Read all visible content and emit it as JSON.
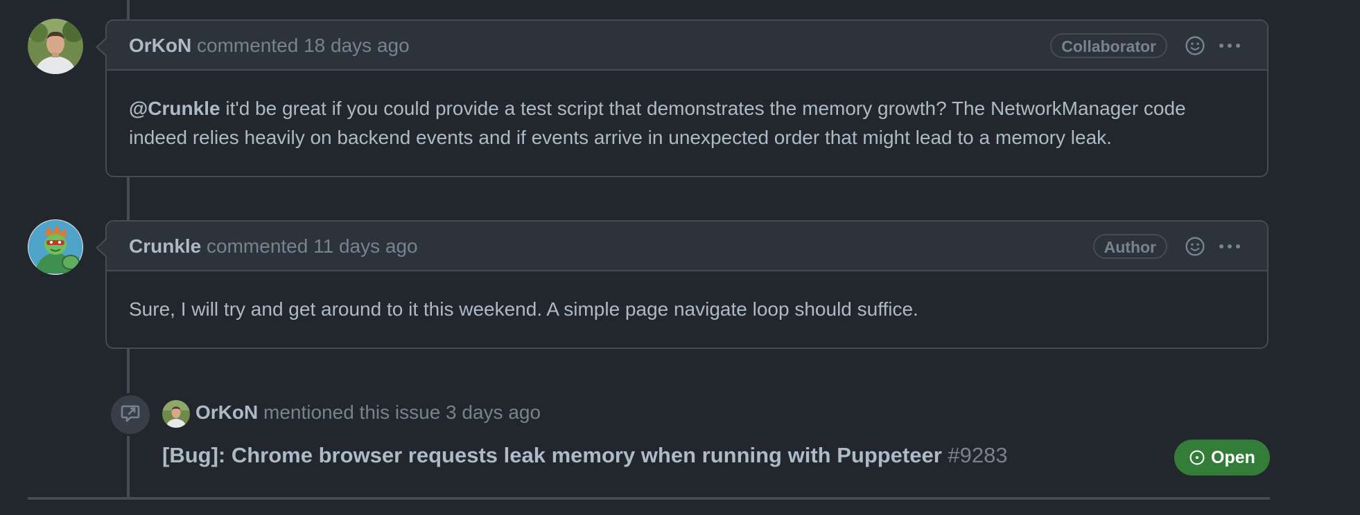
{
  "comments": [
    {
      "author": "OrKoN",
      "action": " commented ",
      "time": "18 days ago",
      "role": "Collaborator",
      "avatar_icon": "avatar-photo-man",
      "body_mention": "@Crunkle",
      "body_text": " it'd be great if you could provide a test script that demonstrates the memory growth? The NetworkManager code indeed relies heavily on backend events and if events arrive in unexpected order that might lead to a memory leak."
    },
    {
      "author": "Crunkle",
      "action": " commented ",
      "time": "11 days ago",
      "role": "Author",
      "avatar_icon": "avatar-cartoon-turtle",
      "body_text": "Sure, I will try and get around to it this weekend. A simple page navigate loop should suffice."
    }
  ],
  "event": {
    "icon": "cross-reference-icon",
    "actor": "OrKoN",
    "action": " mentioned this issue ",
    "time": "3 days ago",
    "issue_title": "[Bug]: Chrome browser requests leak memory when running with Puppeteer",
    "issue_number": "#9283",
    "state": "Open",
    "state_color": "#347d39"
  },
  "icons": {
    "reaction": "smiley-icon",
    "menu": "kebab-icon",
    "state": "issue-opened-icon"
  },
  "colors": {
    "background": "#22272e",
    "header_bg": "#2d333b",
    "border": "#444c56",
    "text": "#adbac7",
    "muted": "#768390"
  }
}
